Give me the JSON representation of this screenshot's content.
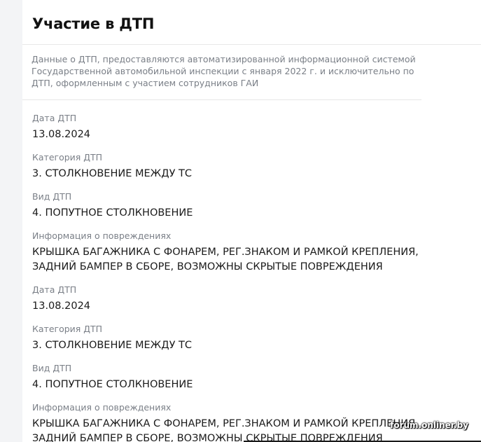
{
  "section": {
    "title": "Участие в ДТП",
    "notice": "Данные о ДТП, предоставляются автоматизированной информационной системой Государственной автомобильной инспекции с января 2022 г. и исключительно по ДТП, оформленным с участием сотрудников ГАИ"
  },
  "labels": {
    "date": "Дата ДТП",
    "category": "Категория ДТП",
    "type": "Вид ДТП",
    "damage": "Информация о повреждениях"
  },
  "accidents": [
    {
      "date": "13.08.2024",
      "category": "3. СТОЛКНОВЕНИЕ МЕЖДУ ТС",
      "type": "4. ПОПУТНОЕ СТОЛКНОВЕНИЕ",
      "damage": "КРЫШКА БАГАЖНИКА С ФОНАРЕМ, РЕГ.ЗНАКОМ И РАМКОЙ КРЕПЛЕНИЯ, ЗАДНИЙ БАМПЕР В СБОРЕ, ВОЗМОЖНЫ СКРЫТЫЕ ПОВРЕЖДЕНИЯ"
    },
    {
      "date": "13.08.2024",
      "category": "3. СТОЛКНОВЕНИЕ МЕЖДУ ТС",
      "type": "4. ПОПУТНОЕ СТОЛКНОВЕНИЕ",
      "damage": "КРЫШКА БАГАЖНИКА С ФОНАРЕМ, РЕГ.ЗНАКОМ И РАМКОЙ КРЕПЛЕНИЯ, ЗАДНИЙ БАМПЕР В СБОРЕ, ВОЗМОЖНЫ СКРЫТЫЕ ПОВРЕЖДЕНИЯ"
    }
  ],
  "watermark": "forum.onliner.by"
}
